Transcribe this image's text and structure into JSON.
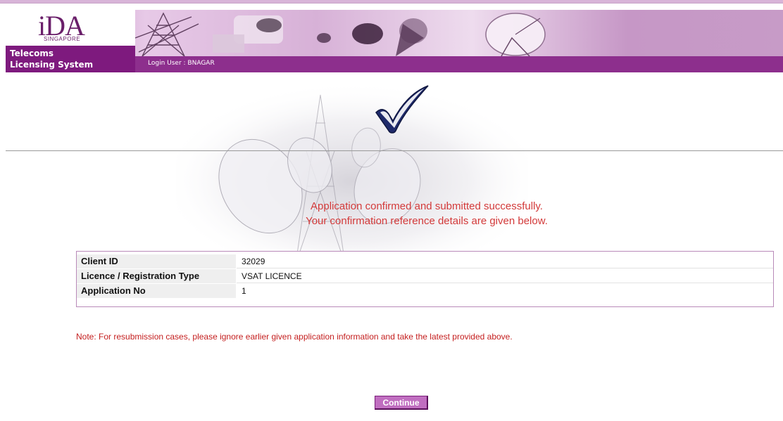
{
  "header": {
    "logo_main": "iDA",
    "logo_sub": "SINGAPORE",
    "system_title_line1": "Telecoms",
    "system_title_line2": "Licensing System",
    "login_user": "Login User : BNAGAR"
  },
  "confirmation": {
    "line1": "Application confirmed and submitted successfully.",
    "line2": "Your confirmation reference details are given below."
  },
  "details": [
    {
      "label": "Client ID",
      "value": "32029"
    },
    {
      "label": "Licence / Registration Type",
      "value": "VSAT LICENCE"
    },
    {
      "label": "Application No",
      "value": "1"
    }
  ],
  "note": "Note: For resubmission cases, please ignore earlier given application information and take the latest provided above.",
  "buttons": {
    "continue": "Continue"
  },
  "colors": {
    "brand_purple": "#7e1a7e",
    "message_red": "#d33a3a",
    "button_purple": "#c06ec0"
  },
  "icons": {
    "success": "checkmark-icon",
    "background": "satellite-dish-image"
  }
}
